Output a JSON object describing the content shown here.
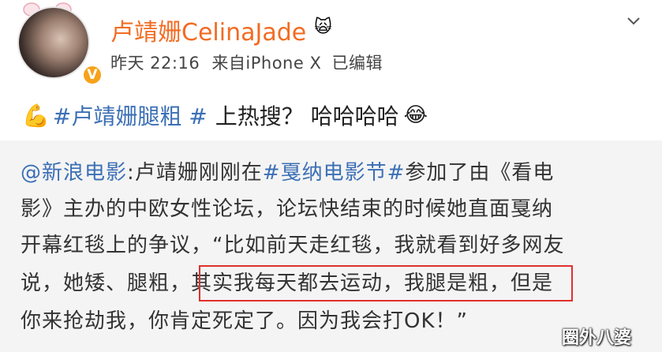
{
  "profile": {
    "username": "卢靖姗CelinaJade",
    "name_emoji": "🙀",
    "verified_badge": "V",
    "timestamp": "昨天 22:16",
    "source": "来自iPhone X",
    "edited": "已编辑"
  },
  "post": {
    "hashtag": "#卢靖姗腿粗 #",
    "text": "上热搜？ 哈哈哈哈",
    "emoji_arm": "💪",
    "emoji_laugh": "😂"
  },
  "repost": {
    "author": "@新浪电影",
    "line1_a": ":卢靖姗刚刚在",
    "line1_tag": "#戛纳电影节#",
    "line1_b": "参加了由《看电",
    "line2": "影》主办的中欧女性论坛，论坛快结束的时候她直面戛纳",
    "line3": "开幕红毯上的争议，“比如前天走红毯，我就看到好多网友",
    "line4": "说，她矮、腿粗，其实我每天都去运动，我腿是粗，但是",
    "line5": "你来抢劫我，你肯定死定了。因为我会打OK！”"
  },
  "watermark": "圈外八婆",
  "colors": {
    "username": "#f26c22",
    "link": "#3b6fb5",
    "highlight_box": "#e0302c",
    "repost_bg": "#f4f4f4",
    "badge": "#f7a21b"
  }
}
